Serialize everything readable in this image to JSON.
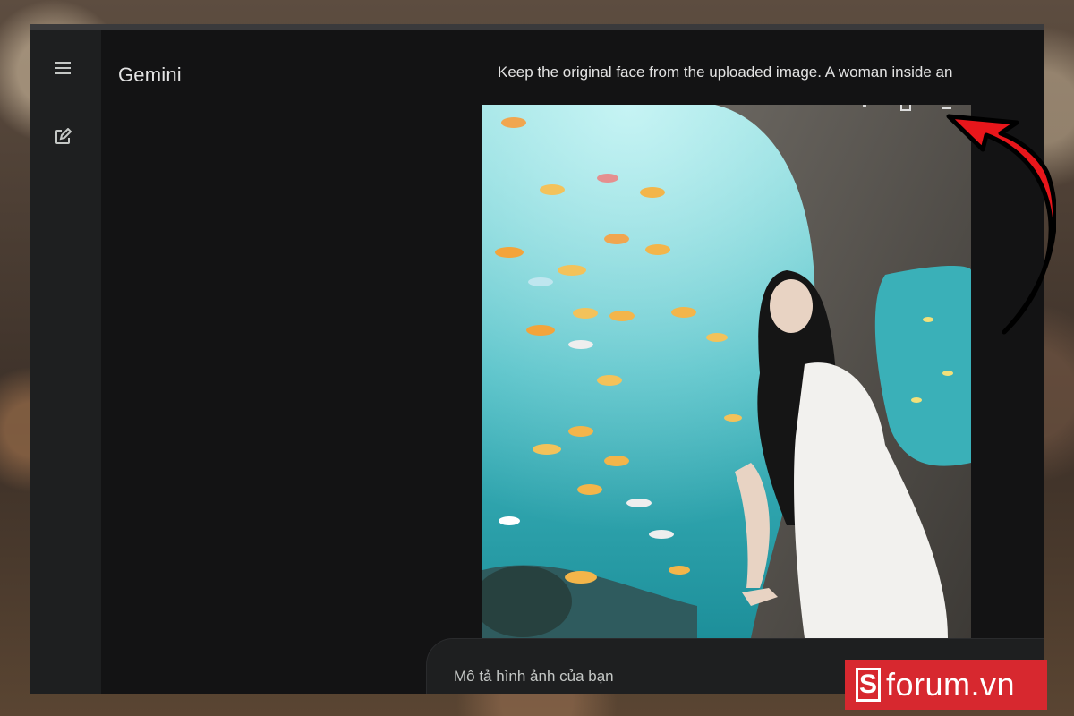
{
  "app": {
    "title": "Gemini"
  },
  "rail": {
    "menu_icon": "hamburger-menu-icon",
    "new_chat_icon": "edit-square-icon"
  },
  "chat": {
    "prompt": "Keep the original face from the uploaded image. A woman inside an",
    "image_actions": [
      "share-icon",
      "copy-icon",
      "download-icon"
    ]
  },
  "input": {
    "placeholder": "Mô tả hình ảnh của bạn"
  },
  "watermark": {
    "logo_letter": "S",
    "text": "forum.vn"
  },
  "colors": {
    "window_bg": "#131314",
    "rail_bg": "#1e1f20",
    "text": "#e3e3e3",
    "arrow": "#e8161b",
    "badge": "#d7282f"
  }
}
